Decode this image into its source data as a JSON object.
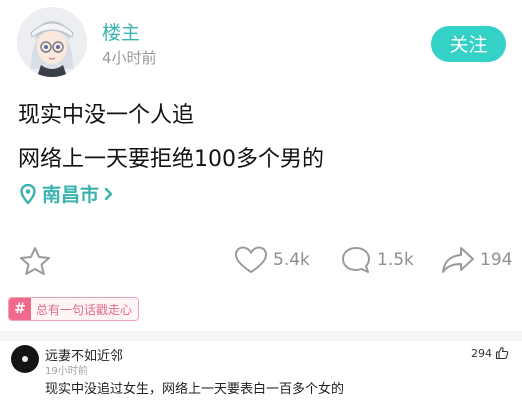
{
  "post": {
    "author": "楼主",
    "time": "4小时前",
    "follow_label": "关注",
    "lines": [
      "现实中没一个人追",
      "网络上一天要拒绝100多个男的"
    ],
    "location": "南昌市"
  },
  "actions": {
    "likes": "5.4k",
    "comments": "1.5k",
    "shares": "194"
  },
  "topic": {
    "icon": "#",
    "label": "总有一句话戳走心"
  },
  "comment": {
    "author": "远妻不如近邻",
    "time": "19小时前",
    "likes": "294",
    "text": "现实中没追过女生，网络上一天要表白一百多个女的"
  },
  "colors": {
    "accent": "#33d1c6",
    "location": "#3ab3b0",
    "tag": "#f06a8c"
  }
}
